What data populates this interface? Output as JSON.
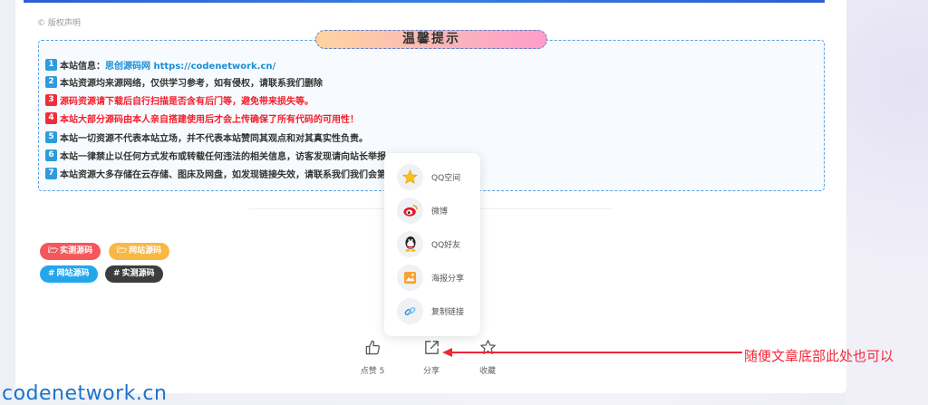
{
  "copyright": "© 版权声明",
  "notice": {
    "title": "温馨提示",
    "rows": [
      {
        "num": "1",
        "label": "本站信息：",
        "link": "思创源码网 https://codenetwork.cn/"
      },
      {
        "num": "2",
        "text": "本站资源均来源网络，仅供学习参考，如有侵权，请联系我们删除"
      },
      {
        "num": "3",
        "text": "源码资源请下载后自行扫描是否含有后门等，避免带来损失等。"
      },
      {
        "num": "4",
        "text": "本站大部分源码由本人亲自搭建使用后才会上传确保了所有代码的可用性！"
      },
      {
        "num": "5",
        "text": "本站一切资源不代表本站立场，并不代表本站赞同其观点和对其真实性负责。"
      },
      {
        "num": "6",
        "text": "本站一律禁止以任何方式发布或转载任何违法的相关信息，访客发现请向站长举报"
      },
      {
        "num": "7",
        "text": "本站资源大多存储在云存储、图床及网盘，如发现链接失效，请联系我们我们会第"
      }
    ]
  },
  "tags": {
    "cat1": "实测源码",
    "cat2": "网站源码",
    "tag1": "网站源码",
    "tag2": "实测源码"
  },
  "share": {
    "items": [
      {
        "label": "QQ空间",
        "icon": "qzone-star-icon"
      },
      {
        "label": "微博",
        "icon": "weibo-icon"
      },
      {
        "label": "QQ好友",
        "icon": "qq-penguin-icon"
      },
      {
        "label": "海报分享",
        "icon": "poster-icon"
      },
      {
        "label": "复制链接",
        "icon": "link-icon"
      }
    ]
  },
  "actions": {
    "like": "点赞 5",
    "share": "分享",
    "favorite": "收藏"
  },
  "annotation": "随便文章底部此处也可以",
  "watermark": "codenetwork.cn",
  "colors": {
    "accent_blue": "#2e9bdc",
    "alert_red": "#f0283a",
    "tag_red": "#f4585d",
    "tag_orange": "#f9b744",
    "tag_blue": "#23a7ec",
    "tag_dark": "#3d3d3d"
  }
}
